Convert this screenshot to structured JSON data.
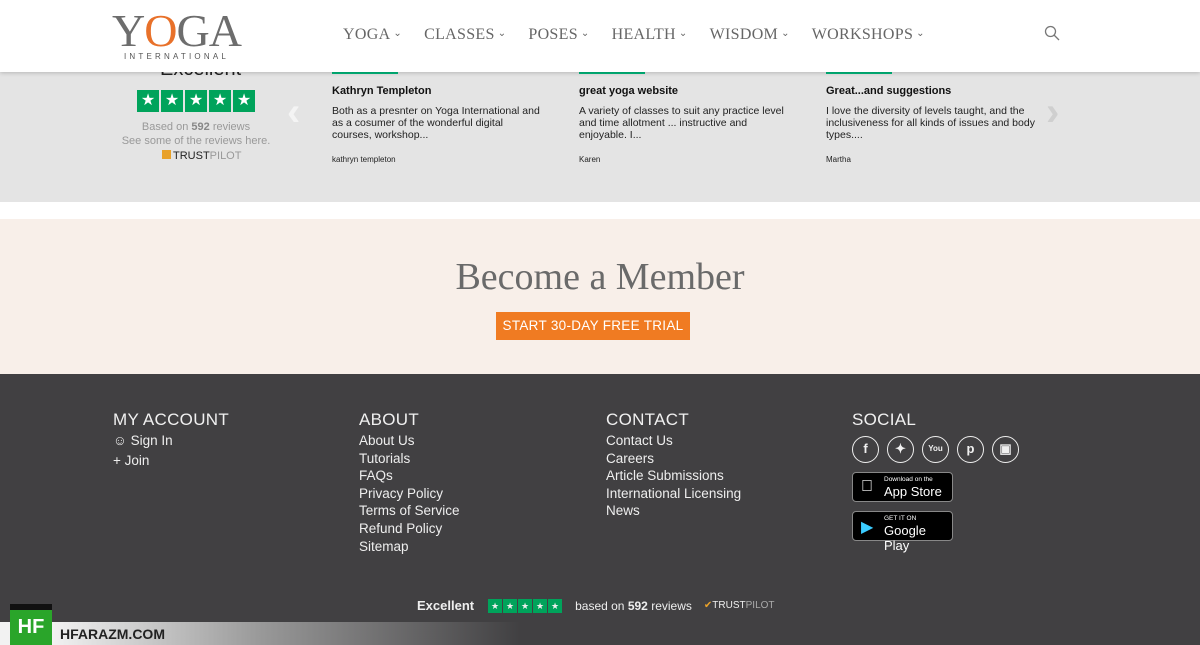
{
  "header": {
    "logo_main": "YOGA",
    "logo_sub": "INTERNATIONAL",
    "nav": [
      "YOGA",
      "CLASSES",
      "POSES",
      "HEALTH",
      "WISDOM",
      "WORKSHOPS"
    ]
  },
  "reviews": {
    "rating": "Excellent",
    "based_prefix": "Based on",
    "count": "592",
    "based_suffix": "reviews",
    "see_some": "See some of the reviews here.",
    "trustpilot_a": "TRUST",
    "trustpilot_b": "PILOT",
    "cards": [
      {
        "title": "Kathryn Templeton",
        "text": "Both as a presnter on Yoga International and as a cosumer of the wonderful digital courses, workshop...",
        "author": "kathryn templeton"
      },
      {
        "title": "great yoga website",
        "text": "A variety of classes to suit any practice level and time allotment ... instructive and enjoyable. I...",
        "author": "Karen"
      },
      {
        "title": "Great...and suggestions",
        "text": "I love the diversity of levels taught, and the inclusiveness for all kinds of issues and body types....",
        "author": "Martha"
      }
    ]
  },
  "member": {
    "title": "Become a Member",
    "cta": "START 30-DAY FREE TRIAL"
  },
  "footer": {
    "account": {
      "title": "MY ACCOUNT",
      "links": [
        "Sign In",
        "Join"
      ]
    },
    "about": {
      "title": "ABOUT",
      "links": [
        "About Us",
        "Tutorials",
        "FAQs",
        "Privacy Policy",
        "Terms of Service",
        "Refund Policy",
        "Sitemap"
      ]
    },
    "contact": {
      "title": "CONTACT",
      "links": [
        "Contact Us",
        "Careers",
        "Article Submissions",
        "International Licensing",
        "News"
      ]
    },
    "social": {
      "title": "SOCIAL",
      "icons": [
        "facebook",
        "twitter",
        "youtube",
        "pinterest",
        "instagram"
      ],
      "appstore_small": "Download on the",
      "appstore_big": "App Store",
      "play_small": "GET IT ON",
      "play_big": "Google Play"
    },
    "bottom": {
      "rating": "Excellent",
      "based_prefix": "based on",
      "count": "592",
      "based_suffix": "reviews",
      "trustpilot_a": "TRUST",
      "trustpilot_b": "PILOT"
    }
  },
  "watermark": {
    "logo": "HF",
    "text": "HFARAZM.COM"
  },
  "colors": {
    "accent": "#f07b22",
    "trustpilot_green": "#00a35b",
    "footer_bg": "#414042"
  }
}
